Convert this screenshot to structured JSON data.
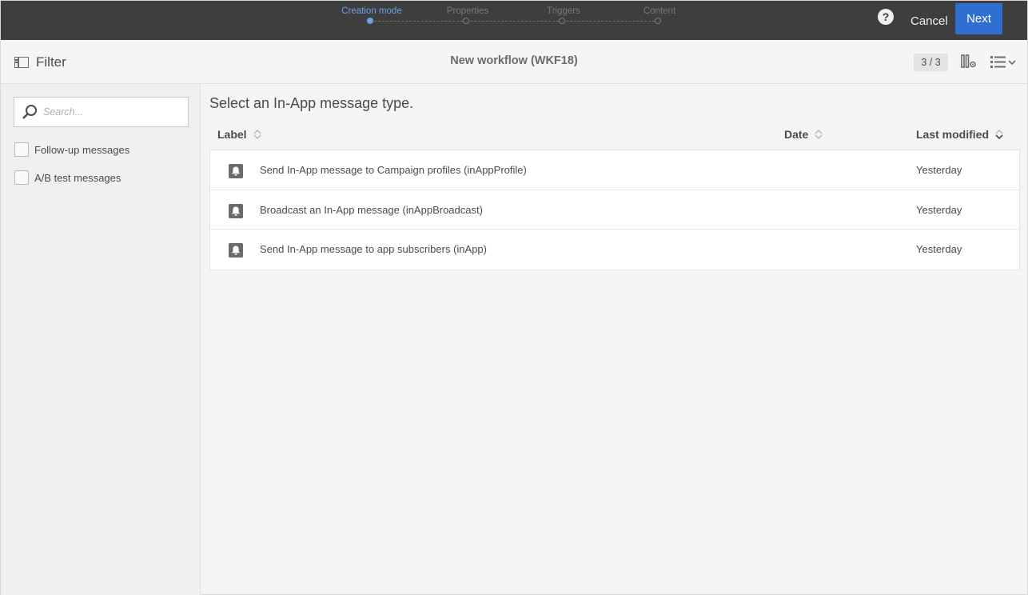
{
  "stepper": {
    "steps": [
      {
        "label": "Creation mode",
        "active": true
      },
      {
        "label": "Properties",
        "active": false
      },
      {
        "label": "Triggers",
        "active": false
      },
      {
        "label": "Content",
        "active": false
      }
    ]
  },
  "topbar": {
    "help_icon": "?",
    "cancel_label": "Cancel",
    "next_label": "Next"
  },
  "header": {
    "filter_label": "Filter",
    "title": "New workflow (WKF18)",
    "count": "3 / 3",
    "icons": [
      "panel-icon",
      "column-settings-icon",
      "list-view-icon"
    ]
  },
  "sidebar": {
    "search_placeholder": "Search...",
    "filters": [
      {
        "label": "Follow-up messages",
        "checked": false
      },
      {
        "label": "A/B test messages",
        "checked": false
      }
    ]
  },
  "main": {
    "title": "Select an In-App message type.",
    "columns": [
      "Label",
      "Date",
      "Last modified"
    ],
    "rows": [
      {
        "label": "Send In-App message to Campaign profiles (inAppProfile)",
        "date": "",
        "modified": "Yesterday",
        "icon": "bell-icon"
      },
      {
        "label": "Broadcast an In-App message (inAppBroadcast)",
        "date": "",
        "modified": "Yesterday",
        "icon": "bell-icon"
      },
      {
        "label": "Send In-App message to app subscribers (inApp)",
        "date": "",
        "modified": "Yesterday",
        "icon": "bell-icon"
      }
    ]
  },
  "colors": {
    "topbar": "#3e3e3e",
    "accent": "#2f6fd1",
    "active_step": "#6aa0e6"
  }
}
